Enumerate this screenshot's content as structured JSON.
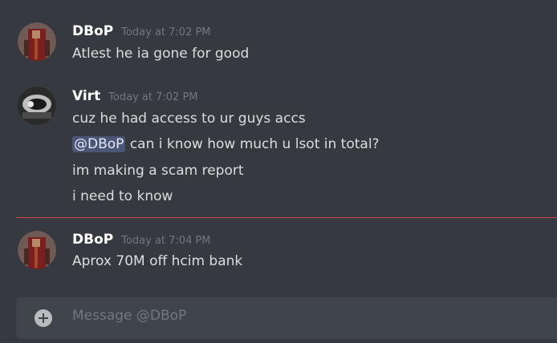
{
  "messages": [
    {
      "username": "DBoP",
      "timestamp": "Today at 7:02 PM",
      "lines": [
        "Atlest he ia gone for good"
      ]
    },
    {
      "username": "Virt",
      "timestamp": "Today at 7:02 PM",
      "lines": [
        "cuz he had access to ur guys accs",
        "can i know how much u lsot in total?",
        "im making a scam report",
        "i need to know"
      ],
      "mention": "@DBoP"
    },
    {
      "username": "DBoP",
      "timestamp": "Today at 7:04 PM",
      "lines": [
        "Aprox 70M off hcim bank"
      ]
    }
  ],
  "composer": {
    "placeholder": "Message @DBoP"
  },
  "colors": {
    "background": "#36393f",
    "composer_bg": "#40444b",
    "new_messages_divider": "#d0454a",
    "mention_bg": "#5865a0"
  }
}
